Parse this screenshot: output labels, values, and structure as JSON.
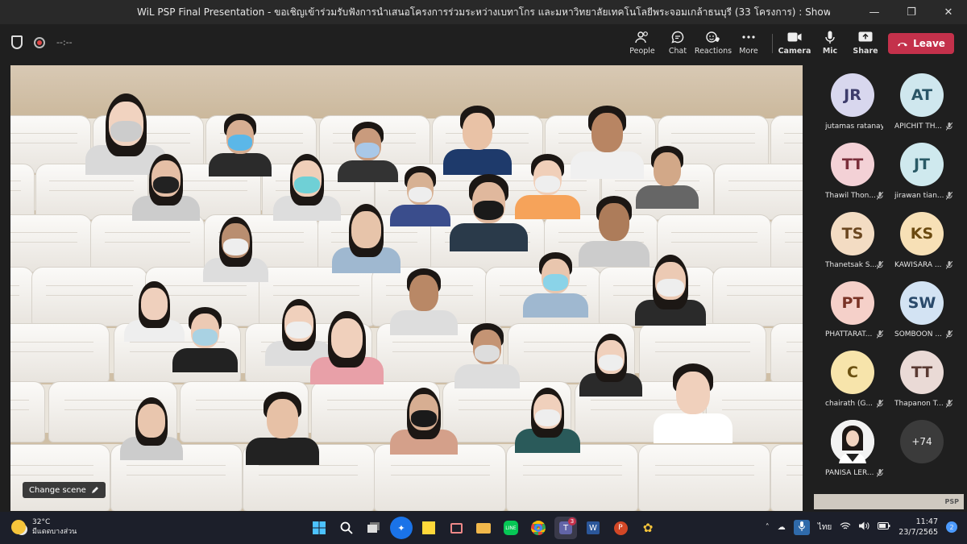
{
  "window": {
    "title": "WiL PSP Final Presentation - ขอเชิญเข้าร่วมรับฟังการนำเสนอโครงการร่วมระหว่างเบทาโกร และมหาวิทยาลัยเทคโนโลยีพระจอมเกล้าธนบุรี (33 โครงการ) : Show and Share",
    "minimize": "—",
    "maximize": "❐",
    "close": "✕"
  },
  "toolbar": {
    "timer": "--:--",
    "people": "People",
    "chat": "Chat",
    "reactions": "Reactions",
    "more": "More",
    "camera": "Camera",
    "mic": "Mic",
    "share": "Share",
    "leave": "Leave"
  },
  "stage": {
    "change_scene": "Change scene"
  },
  "roster": {
    "participants": [
      {
        "initials": "JR",
        "name": "jutamas ratanayu",
        "muted": false,
        "color": "#d8d7ee",
        "text": "#3d3c6b"
      },
      {
        "initials": "AT",
        "name": "APICHIT TH...",
        "muted": true,
        "color": "#cfe7ee",
        "text": "#2a5566"
      },
      {
        "initials": "TT",
        "name": "Thawil Thon...",
        "muted": true,
        "color": "#f3d1d6",
        "text": "#7a2e3a"
      },
      {
        "initials": "JT",
        "name": "jirawan tian...",
        "muted": true,
        "color": "#cfe9ee",
        "text": "#2a5a66"
      },
      {
        "initials": "TS",
        "name": "Thanetsak S...",
        "muted": true,
        "color": "#f3dcc3",
        "text": "#6b4720"
      },
      {
        "initials": "KS",
        "name": "KAWISARA ...",
        "muted": true,
        "color": "#f7e0b6",
        "text": "#6b4a10"
      },
      {
        "initials": "PT",
        "name": "PHATTARAT...",
        "muted": true,
        "color": "#f5d0c9",
        "text": "#7a3326"
      },
      {
        "initials": "SW",
        "name": "SOMBOON ...",
        "muted": true,
        "color": "#d3e3f3",
        "text": "#2a4a6b"
      },
      {
        "initials": "C",
        "name": "chairath (G...",
        "muted": true,
        "color": "#f7e4ab",
        "text": "#6b5010"
      },
      {
        "initials": "TT",
        "name": "Thapanon T...",
        "muted": true,
        "color": "#eadad6",
        "text": "#5a3a33"
      },
      {
        "initials": "",
        "name": "PANISA LER...",
        "muted": true,
        "color": "#f2f2f2",
        "text": "#222"
      }
    ],
    "overflow": "+74",
    "logo_text": "PSP"
  },
  "taskbar": {
    "temp": "32°C",
    "weather": "มีแดดบางส่วน",
    "language": "ไทย",
    "time": "11:47",
    "date": "23/7/2565",
    "notifications": "2",
    "teams_badge": "3"
  }
}
